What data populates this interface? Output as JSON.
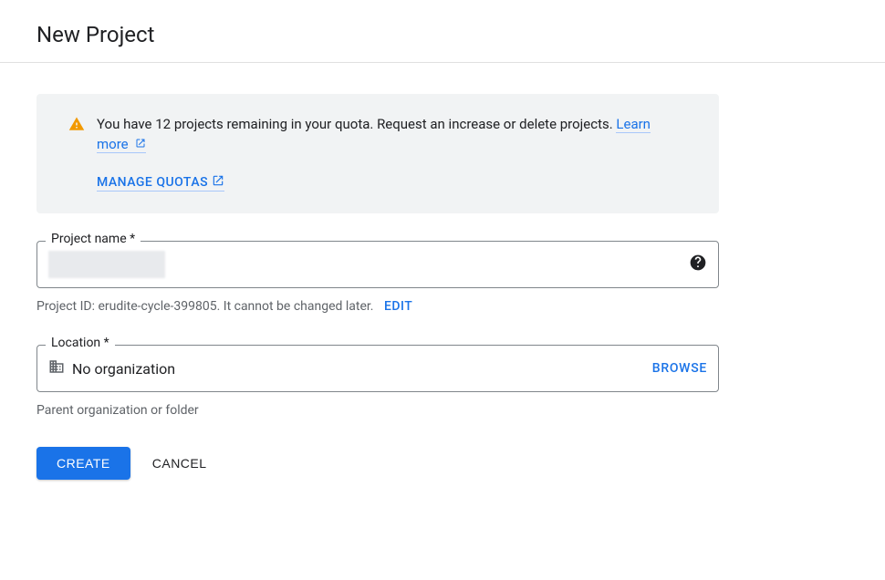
{
  "page": {
    "title": "New Project"
  },
  "quota": {
    "message_before": "You have 12 projects remaining in your quota. Request an increase or delete projects. ",
    "learn_more": "Learn more",
    "manage_label": "MANAGE QUOTAS"
  },
  "project_name": {
    "label": "Project name *",
    "helper_prefix": "Project ID: ",
    "project_id": "erudite-cycle-399805",
    "helper_suffix": ". It cannot be changed later.",
    "edit_label": "EDIT"
  },
  "location": {
    "label": "Location *",
    "value": "No organization",
    "browse_label": "BROWSE",
    "helper": "Parent organization or folder"
  },
  "buttons": {
    "create": "CREATE",
    "cancel": "CANCEL"
  }
}
